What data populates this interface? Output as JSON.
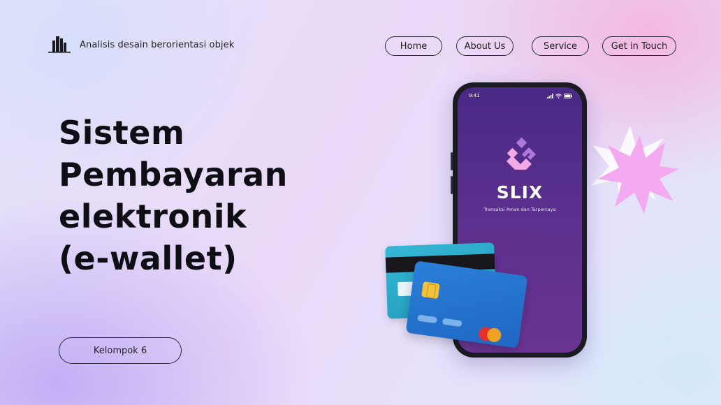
{
  "header": {
    "brand_text": "Analisis desain berorientasi objek",
    "logo_icon": "city-skyline-icon",
    "nav": [
      "Home",
      "About Us",
      "Service",
      "Get in Touch"
    ]
  },
  "hero": {
    "title_lines": [
      "Sistem",
      "Pembayaran",
      "elektronik",
      "(e-wallet)"
    ],
    "group_button": "Kelompok 6"
  },
  "phone": {
    "time": "9:41",
    "app_name": "SLIX",
    "tagline": "Transaksi Aman dan Terpercaya"
  },
  "colors": {
    "phone_screen": "#5a2f8d",
    "logo_light": "#f2a9e4",
    "logo_dark": "#b078d8",
    "star": "#f4aaf0",
    "card_back": "#2aa8c9",
    "card_front": "#2173cc"
  }
}
